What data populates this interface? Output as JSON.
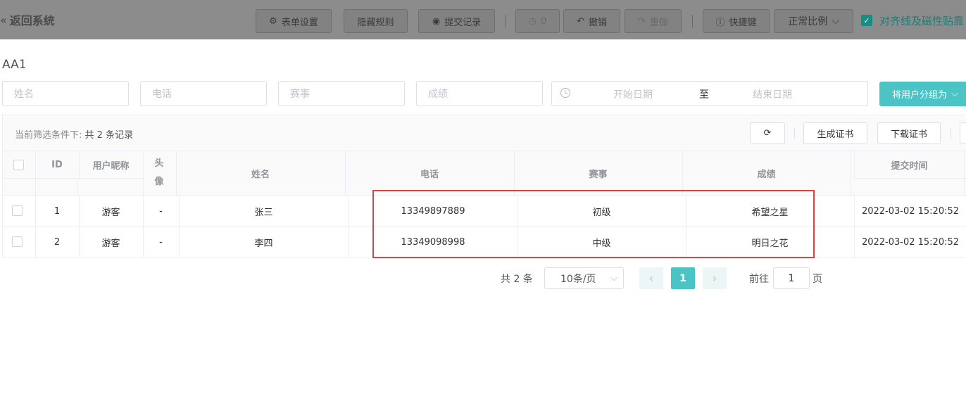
{
  "topbar": {
    "back_label": "返回系统",
    "buttons": {
      "form_settings": "表单设置",
      "hide_rules": "隐藏规则",
      "submit_records": "提交记录",
      "history_count": "0",
      "undo": "撤销",
      "redo": "重做",
      "shortcuts": "快捷键",
      "scale": "正常比例"
    },
    "snap_label": "对齐线及磁性贴靠",
    "snap_checked": true
  },
  "form_title": "AA1",
  "filters": {
    "name_placeholder": "姓名",
    "phone_placeholder": "电话",
    "event_placeholder": "赛事",
    "score_placeholder": "成绩",
    "start_date_placeholder": "开始日期",
    "range_separator": "至",
    "end_date_placeholder": "结束日期",
    "group_button": "将用户分组为"
  },
  "summary": {
    "prefix": "当前筛选条件下:",
    "count_text": "共 2 条记录"
  },
  "header_buttons": {
    "generate_cert": "生成证书",
    "download_cert": "下载证书"
  },
  "table": {
    "columns": {
      "id": "ID",
      "nickname": "用户昵称",
      "avatar": "头像",
      "name": "姓名",
      "phone": "电话",
      "event": "赛事",
      "score": "成绩",
      "submit_time": "提交时间"
    },
    "rows": [
      {
        "id": "1",
        "nickname": "游客",
        "avatar": "-",
        "name": "张三",
        "phone": "13349897889",
        "event": "初级",
        "score": "希望之星",
        "submit_time": "2022-03-02 15:20:52"
      },
      {
        "id": "2",
        "nickname": "游客",
        "avatar": "-",
        "name": "李四",
        "phone": "13349098998",
        "event": "中级",
        "score": "明日之花",
        "submit_time": "2022-03-02 15:20:52"
      }
    ]
  },
  "pagination": {
    "total_text": "共 2 条",
    "page_size": "10条/页",
    "current_page": "1",
    "goto_label": "前往",
    "goto_value": "1",
    "page_suffix": "页"
  },
  "colors": {
    "accent": "#4cc3c5",
    "highlight_border": "#d64545",
    "toolbar_overlay": "#8c8c8c"
  }
}
